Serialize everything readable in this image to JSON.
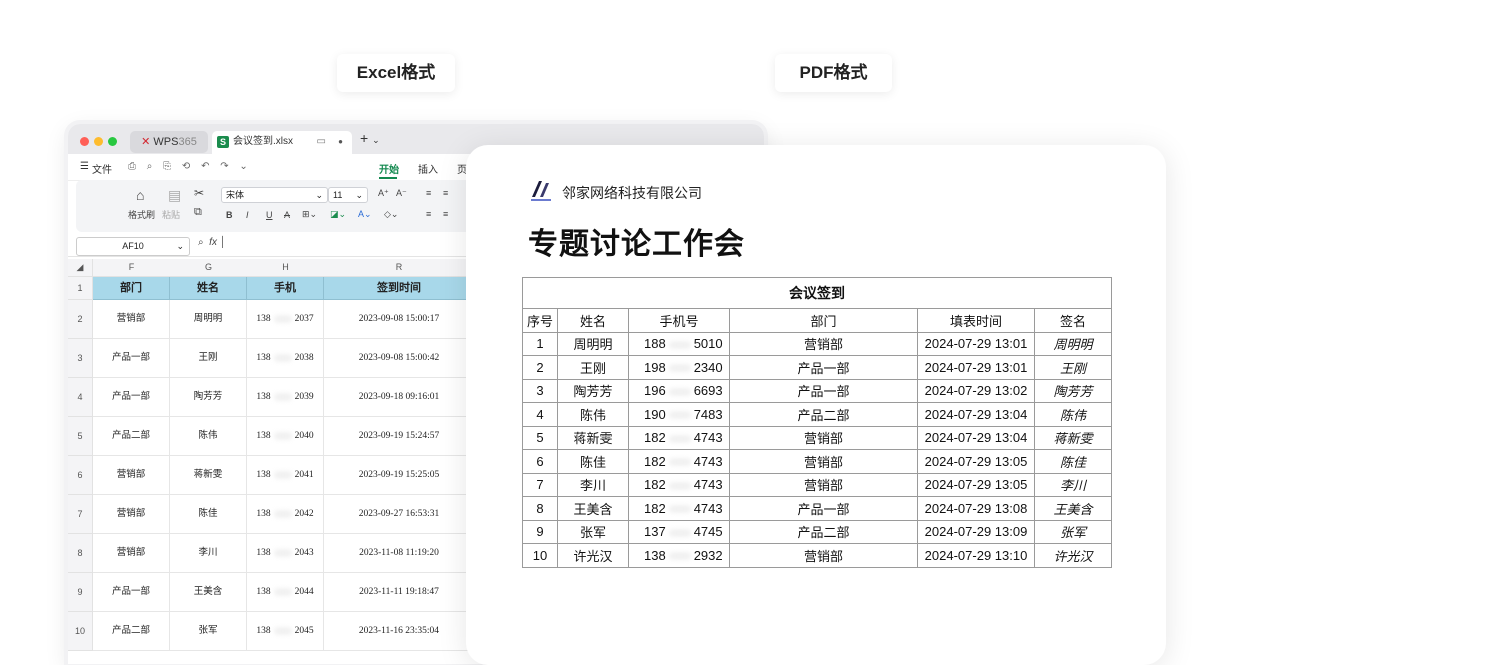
{
  "labels": {
    "excel": "Excel格式",
    "pdf": "PDF格式"
  },
  "excel": {
    "tabs": {
      "wps_logo": "WPS",
      "wps_suffix": "365",
      "file_icon": "S",
      "file_name": "会议签到.xlsx"
    },
    "menu": {
      "file": "文件",
      "start": "开始",
      "insert": "插入",
      "page": "页"
    },
    "ribbon": {
      "format_painter": "格式刷",
      "paste": "粘贴",
      "font": "宋体",
      "font_size": "11",
      "grow": "A⁺",
      "shrink": "A⁻",
      "bold": "B",
      "italic": "I",
      "underline": "U",
      "strike": "A"
    },
    "name_box": "AF10",
    "fx": "fx",
    "columns": [
      "F",
      "G",
      "H",
      "R"
    ],
    "headers": [
      "部门",
      "姓名",
      "手机",
      "签到时间"
    ],
    "rows": [
      {
        "num": "2",
        "dept": "营销部",
        "name": "周明明",
        "phone_a": "138",
        "phone_b": "2037",
        "time": "2023-09-08 15:00:17"
      },
      {
        "num": "3",
        "dept": "产品一部",
        "name": "王刚",
        "phone_a": "138",
        "phone_b": "2038",
        "time": "2023-09-08 15:00:42"
      },
      {
        "num": "4",
        "dept": "产品一部",
        "name": "陶芳芳",
        "phone_a": "138",
        "phone_b": "2039",
        "time": "2023-09-18 09:16:01"
      },
      {
        "num": "5",
        "dept": "产品二部",
        "name": "陈伟",
        "phone_a": "138",
        "phone_b": "2040",
        "time": "2023-09-19 15:24:57"
      },
      {
        "num": "6",
        "dept": "营销部",
        "name": "蒋新雯",
        "phone_a": "138",
        "phone_b": "2041",
        "time": "2023-09-19 15:25:05"
      },
      {
        "num": "7",
        "dept": "营销部",
        "name": "陈佳",
        "phone_a": "138",
        "phone_b": "2042",
        "time": "2023-09-27 16:53:31"
      },
      {
        "num": "8",
        "dept": "营销部",
        "name": "李川",
        "phone_a": "138",
        "phone_b": "2043",
        "time": "2023-11-08 11:19:20"
      },
      {
        "num": "9",
        "dept": "产品一部",
        "name": "王美含",
        "phone_a": "138",
        "phone_b": "2044",
        "time": "2023-11-11 19:18:47"
      },
      {
        "num": "10",
        "dept": "产品二部",
        "name": "张军",
        "phone_a": "138",
        "phone_b": "2045",
        "time": "2023-11-16 23:35:04"
      }
    ]
  },
  "pdf": {
    "company": "邻家网络科技有限公司",
    "title": "专题讨论工作会",
    "table_caption": "会议签到",
    "headers": [
      "序号",
      "姓名",
      "手机号",
      "部门",
      "填表时间",
      "签名"
    ],
    "rows": [
      {
        "no": "1",
        "name": "周明明",
        "phone_a": "188",
        "phone_b": "5010",
        "dept": "营销部",
        "time": "2024-07-29 13:01",
        "sig": "周明明"
      },
      {
        "no": "2",
        "name": "王刚",
        "phone_a": "198",
        "phone_b": "2340",
        "dept": "产品一部",
        "time": "2024-07-29 13:01",
        "sig": "王刚"
      },
      {
        "no": "3",
        "name": "陶芳芳",
        "phone_a": "196",
        "phone_b": "6693",
        "dept": "产品一部",
        "time": "2024-07-29 13:02",
        "sig": "陶芳芳"
      },
      {
        "no": "4",
        "name": "陈伟",
        "phone_a": "190",
        "phone_b": "7483",
        "dept": "产品二部",
        "time": "2024-07-29 13:04",
        "sig": "陈伟"
      },
      {
        "no": "5",
        "name": "蒋新雯",
        "phone_a": "182",
        "phone_b": "4743",
        "dept": "营销部",
        "time": "2024-07-29 13:04",
        "sig": "蒋新雯"
      },
      {
        "no": "6",
        "name": "陈佳",
        "phone_a": "182",
        "phone_b": "4743",
        "dept": "营销部",
        "time": "2024-07-29 13:05",
        "sig": "陈佳"
      },
      {
        "no": "7",
        "name": "李川",
        "phone_a": "182",
        "phone_b": "4743",
        "dept": "营销部",
        "time": "2024-07-29 13:05",
        "sig": "李川"
      },
      {
        "no": "8",
        "name": "王美含",
        "phone_a": "182",
        "phone_b": "4743",
        "dept": "产品一部",
        "time": "2024-07-29 13:08",
        "sig": "王美含"
      },
      {
        "no": "9",
        "name": "张军",
        "phone_a": "137",
        "phone_b": "4745",
        "dept": "产品二部",
        "time": "2024-07-29 13:09",
        "sig": "张军"
      },
      {
        "no": "10",
        "name": "许光汉",
        "phone_a": "138",
        "phone_b": "2932",
        "dept": "营销部",
        "time": "2024-07-29 13:10",
        "sig": "许光汉"
      }
    ]
  },
  "colors": {
    "accent_green": "#13894f",
    "header_blue": "#a8d8ea",
    "wps_red": "#d2262f"
  }
}
